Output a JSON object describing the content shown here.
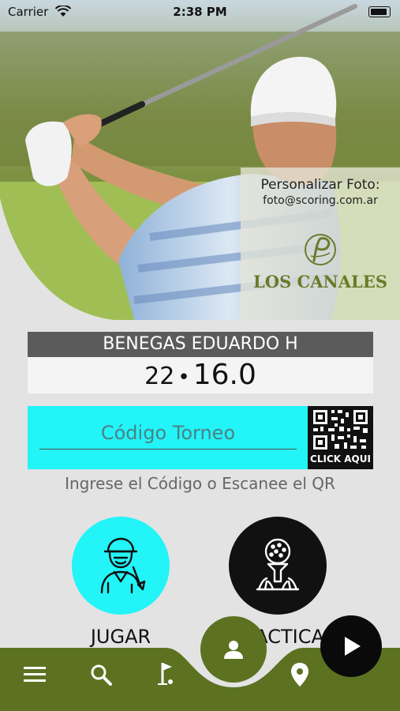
{
  "status_bar": {
    "carrier": "Carrier",
    "time": "2:38 PM"
  },
  "promo": {
    "title": "Personalizar Foto:",
    "email": "foto@scoring.com.ar",
    "club_name": "LOS CANALES"
  },
  "player": {
    "name": "BENEGAS EDUARDO H",
    "handicap_a": "22",
    "separator": "•",
    "handicap_b": "16.0"
  },
  "tournament": {
    "placeholder": "Código Torneo",
    "qr_label": "CLICK AQUI",
    "hint": "Ingrese el Código o Escanee el QR"
  },
  "actions": {
    "jugar_label": "JUGAR",
    "practica_label": "PRACTICA"
  },
  "bottom_nav": {
    "items": [
      "menu-icon",
      "search-icon",
      "golf-flag-icon",
      "profile-icon",
      "location-pin-icon",
      "play-icon"
    ]
  },
  "colors": {
    "accent_cyan": "#22f4f7",
    "brand_green": "#5c7221",
    "name_bar": "#5b5b5b"
  }
}
